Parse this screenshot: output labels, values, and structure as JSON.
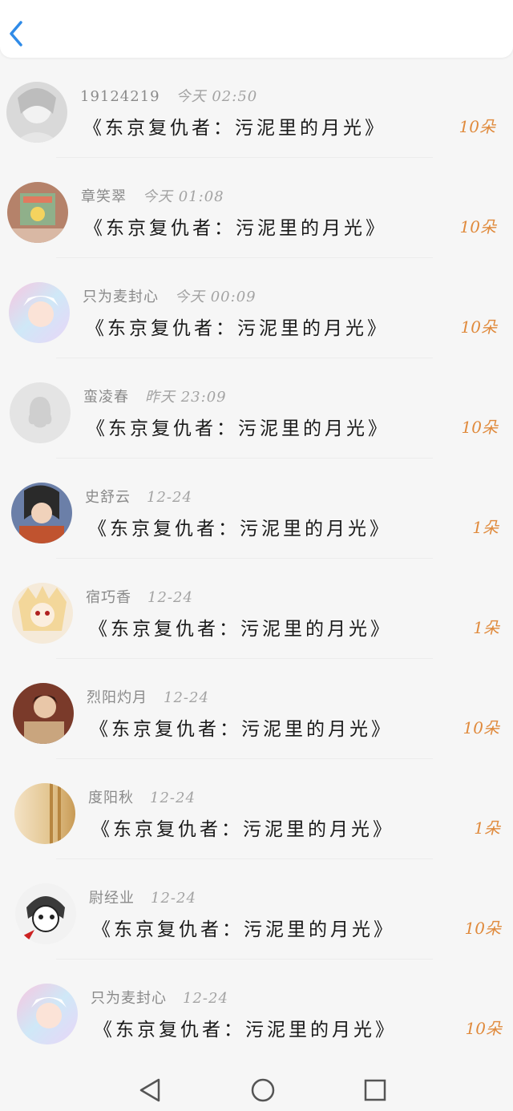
{
  "header": {
    "back_icon": "chevron-left-icon",
    "accent": "#2f8be8"
  },
  "colors": {
    "count": "#e08a3c",
    "meta": "#8a8a8a",
    "title": "#1a1a1a"
  },
  "items": [
    {
      "name": "19124219",
      "time": "今天 02:50",
      "title": "《东京复仇者：污泥里的月光》",
      "count": "10朵",
      "avatar": "sketch-avatar"
    },
    {
      "name": "章笑翠",
      "time": "今天 01:08",
      "title": "《东京复仇者：污泥里的月光》",
      "count": "10朵",
      "avatar": "book-avatar"
    },
    {
      "name": "只为麦封心",
      "time": "今天 00:09",
      "title": "《东京复仇者：污泥里的月光》",
      "count": "10朵",
      "avatar": "holo-avatar"
    },
    {
      "name": "蛮凌春",
      "time": "昨天 23:09",
      "title": "《东京复仇者：污泥里的月光》",
      "count": "10朵",
      "avatar": "default-avatar"
    },
    {
      "name": "史舒云",
      "time": "12-24",
      "title": "《东京复仇者：污泥里的月光》",
      "count": "1朵",
      "avatar": "warrior-avatar"
    },
    {
      "name": "宿巧香",
      "time": "12-24",
      "title": "《东京复仇者：污泥里的月光》",
      "count": "1朵",
      "avatar": "anime-avatar"
    },
    {
      "name": "烈阳灼月",
      "time": "12-24",
      "title": "《东京复仇者：污泥里的月光》",
      "count": "10朵",
      "avatar": "portrait-avatar"
    },
    {
      "name": "度阳秋",
      "time": "12-24",
      "title": "《东京复仇者：污泥里的月光》",
      "count": "1朵",
      "avatar": "curtain-avatar"
    },
    {
      "name": "尉经业",
      "time": "12-24",
      "title": "《东京复仇者：污泥里的月光》",
      "count": "10朵",
      "avatar": "manga-avatar"
    },
    {
      "name": "只为麦封心",
      "time": "12-24",
      "title": "《东京复仇者：污泥里的月光》",
      "count": "10朵",
      "avatar": "holo-avatar"
    }
  ],
  "navbar": {
    "back": "triangle-back-icon",
    "home": "circle-home-icon",
    "recents": "square-recents-icon"
  }
}
